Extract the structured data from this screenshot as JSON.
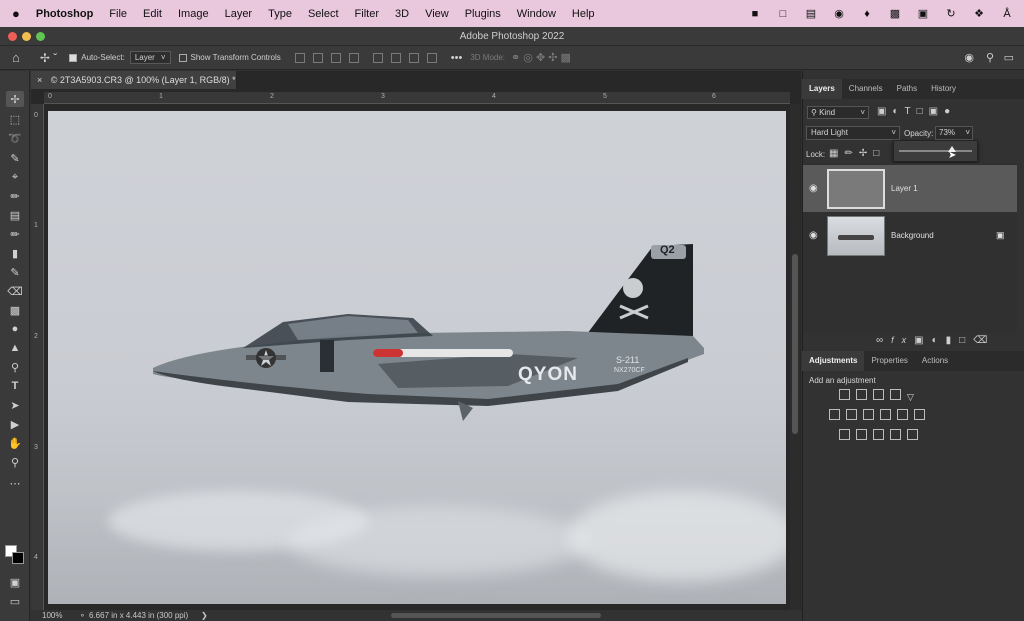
{
  "menubar": {
    "apple": "",
    "app": "Photoshop",
    "items": [
      "File",
      "Edit",
      "Image",
      "Layer",
      "Type",
      "Select",
      "Filter",
      "3D",
      "View",
      "Plugins",
      "Window",
      "Help"
    ]
  },
  "window": {
    "title": "Adobe Photoshop 2022"
  },
  "options": {
    "auto_select_label": "Auto-Select:",
    "auto_select_value": "Layer",
    "show_transform_label": "Show Transform Controls",
    "mode_3d_label": "3D Mode:"
  },
  "document": {
    "tab_label": "© 2T3A5903.CR3 @ 100% (Layer 1, RGB/8) *",
    "zoom": "100%",
    "doc_info": "6.667 in x 4.443 in (300 ppi)",
    "ruler_h": [
      "0",
      "1",
      "2",
      "3",
      "4",
      "5",
      "6"
    ],
    "ruler_v": [
      "0",
      "1",
      "2",
      "3",
      "4"
    ]
  },
  "aircraft": {
    "tail_code": "Q2",
    "name": "QYON",
    "serial_1": "S-211",
    "serial_2": "NX270CF"
  },
  "layers_panel": {
    "tabs": [
      "Layers",
      "Channels",
      "Paths",
      "History"
    ],
    "filter": "Kind",
    "blend_mode": "Hard Light",
    "opacity_label": "Opacity:",
    "opacity_value": "73%",
    "opacity_fraction": 0.73,
    "lock_label": "Lock:",
    "layers": [
      {
        "name": "Layer 1"
      },
      {
        "name": "Background"
      }
    ]
  },
  "adjustments_panel": {
    "tabs": [
      "Adjustments",
      "Properties",
      "Actions"
    ],
    "hint": "Add an adjustment"
  },
  "colors": {
    "menubar": "#e9c8de",
    "panel": "#323232",
    "selected_layer": "#5a5a5a"
  }
}
